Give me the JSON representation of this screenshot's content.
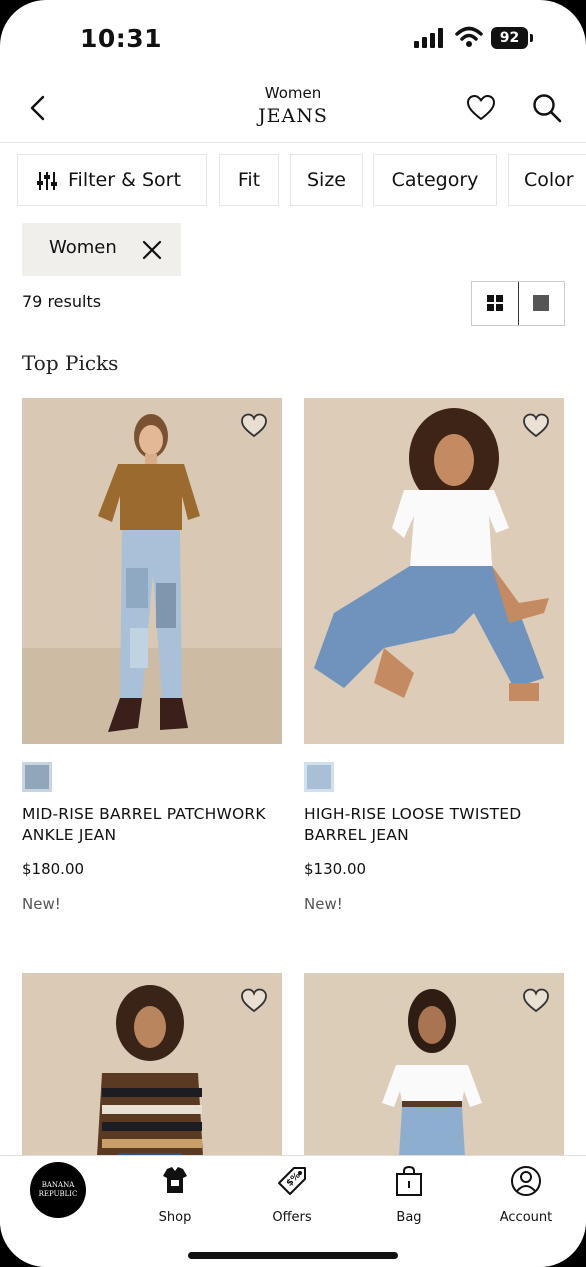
{
  "status_bar": {
    "time": "10:31",
    "battery": "92"
  },
  "header": {
    "subtitle": "Women",
    "title": "JEANS"
  },
  "filters": {
    "filter_sort": "Filter & Sort",
    "fit": "Fit",
    "size": "Size",
    "category": "Category",
    "color": "Color"
  },
  "active_filter": {
    "label": "Women"
  },
  "results": {
    "count_text": "79 results",
    "view_mode": "grid"
  },
  "section": {
    "title": "Top Picks"
  },
  "products": [
    {
      "name": "MID-RISE BARREL PATCHWORK ANKLE JEAN",
      "price": "$180.00",
      "badge": "New!",
      "swatch_color": "#8fa6bb"
    },
    {
      "name": "HIGH-RISE LOOSE TWISTED BARREL JEAN",
      "price": "$130.00",
      "badge": "New!",
      "swatch_color": "#a8bfd6"
    },
    {
      "name": "",
      "price": "",
      "badge": ""
    },
    {
      "name": "",
      "price": "",
      "badge": ""
    }
  ],
  "tabbar": {
    "logo_text": "BANANA REPUBLIC",
    "shop": "Shop",
    "offers": "Offers",
    "bag": "Bag",
    "account": "Account"
  }
}
